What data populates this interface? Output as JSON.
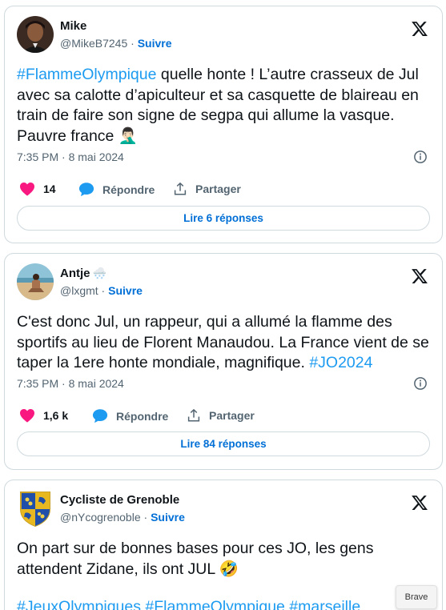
{
  "tweets": [
    {
      "name": "Mike",
      "name_emoji": "",
      "handle": "@MikeB7245",
      "follow": "Suivre",
      "text_parts": [
        "#FlammeOlympique",
        " quelle honte ! L’autre crasseux de Jul avec sa calotte d’apiculteur et sa casquette de blaireau en train de faire son signe de segpa qui allume la vasque. Pauvre france 🤦🏻‍♂️"
      ],
      "time": "7:35 PM · 8 mai 2024",
      "likes": "14",
      "reply_label": "Répondre",
      "share_label": "Partager",
      "read_replies": "Lire 6 réponses"
    },
    {
      "name": "Antje",
      "name_emoji": "🌨️",
      "handle": "@lxgmt",
      "follow": "Suivre",
      "text_parts": [
        "C'est donc Jul, un rappeur, qui a allumé la flamme des sportifs au lieu de Florent Manaudou. La France vient de se taper la 1ere honte mondiale, magnifique. ",
        "#JO2024"
      ],
      "time": "7:35 PM · 8 mai 2024",
      "likes": "1,6 k",
      "reply_label": "Répondre",
      "share_label": "Partager",
      "read_replies": "Lire 84 réponses"
    },
    {
      "name": "Cycliste de Grenoble",
      "name_emoji": "",
      "handle": "@nYcogrenoble",
      "follow": "Suivre",
      "text_parts": [
        "On part sur de bonnes bases pour ces JO, les gens attendent Zidane, ils ont JUL 🤣",
        "#JeuxOlympiques #FlammeOlympique #marseille"
      ]
    }
  ],
  "sep": " · ",
  "browser": {
    "brave_label": "Brave"
  },
  "colors": {
    "like": "#f91880",
    "reply": "#1d9bf0",
    "link": "#1d9bf0",
    "follow": "#006fd6"
  }
}
